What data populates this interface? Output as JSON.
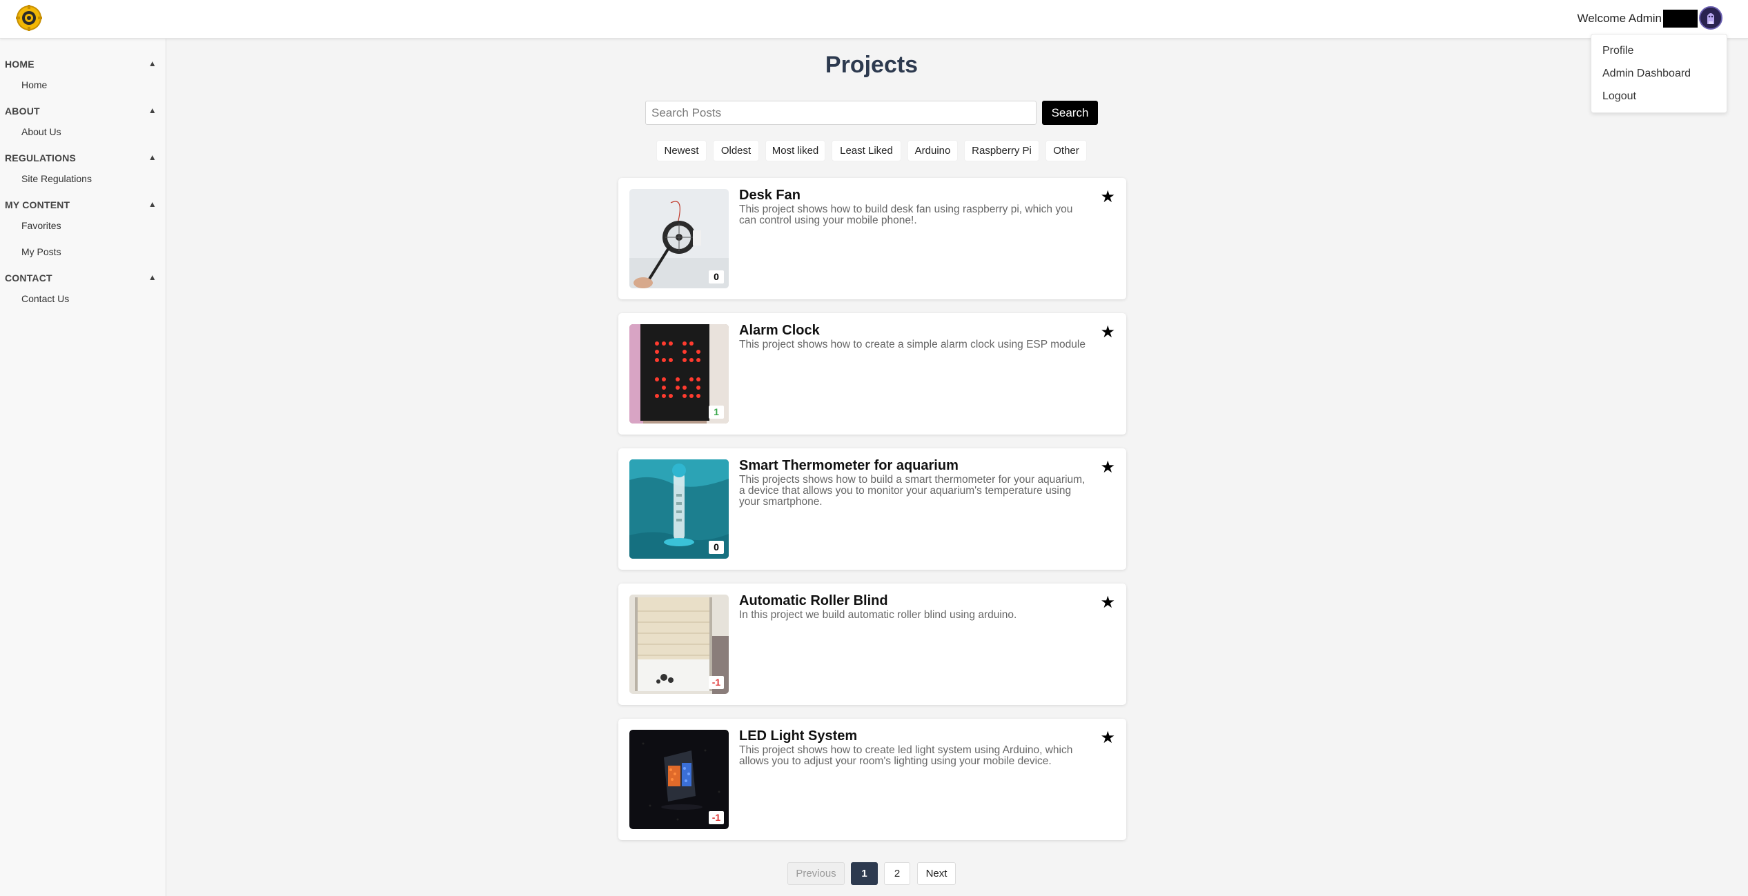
{
  "header": {
    "welcome_text": "Welcome Admin",
    "logo": "gear-logo",
    "avatar": "user-avatar"
  },
  "user_menu": {
    "items": [
      "Profile",
      "Admin Dashboard",
      "Logout"
    ]
  },
  "sidebar": {
    "sections": [
      {
        "title": "HOME",
        "links": [
          "Home"
        ]
      },
      {
        "title": "ABOUT",
        "links": [
          "About Us"
        ]
      },
      {
        "title": "REGULATIONS",
        "links": [
          "Site Regulations"
        ]
      },
      {
        "title": "MY CONTENT",
        "links": [
          "Favorites",
          "My Posts"
        ]
      },
      {
        "title": "CONTACT",
        "links": [
          "Contact Us"
        ]
      }
    ],
    "collapse_glyph": "▲"
  },
  "main": {
    "title": "Projects",
    "search": {
      "placeholder": "Search Posts",
      "value": "",
      "button": "Search"
    },
    "filters": [
      "Newest",
      "Oldest",
      "Most liked",
      "Least Liked",
      "Arduino",
      "Raspberry Pi",
      "Other"
    ]
  },
  "posts": [
    {
      "title": "Desk Fan",
      "description": "This project shows how to build desk fan using raspberry pi, which you can control using your mobile phone!.",
      "score": "0"
    },
    {
      "title": "Alarm Clock",
      "description": "This project shows how to create a simple alarm clock using ESP module",
      "score": "1"
    },
    {
      "title": "Smart Thermometer for aquarium",
      "description": "This projects shows how to build a smart thermometer for your aquarium, a device that allows you to monitor your aquarium's temperature using your smartphone.",
      "score": "0"
    },
    {
      "title": "Automatic Roller Blind",
      "description": "In this project we build automatic roller blind using arduino.",
      "score": "-1"
    },
    {
      "title": "LED Light System",
      "description": "This project shows how to create led light system using Arduino, which allows you to adjust your room's lighting using your mobile device.",
      "score": "-1"
    }
  ],
  "colors": {
    "score_zero": "#000000",
    "score_positive": "#3aa84b",
    "score_negative": "#e03b3b",
    "accent": "#2d3a4f"
  },
  "pagination": {
    "previous": "Previous",
    "pages": [
      "1",
      "2"
    ],
    "current": "1",
    "next": "Next"
  },
  "icons": {
    "star": "★"
  }
}
